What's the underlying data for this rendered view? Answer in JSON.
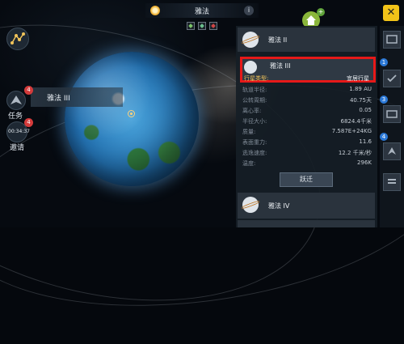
{
  "topbar": {
    "title": "雅法"
  },
  "left": {
    "mission_label": "任务",
    "mission_badge": "4",
    "timer_value": "00:34:37",
    "timer_label": "邀请",
    "timer_badge": "4",
    "planet_tag": "雅法 III",
    "planet_tag_badge": "4"
  },
  "panel": {
    "card_top": "雅法 II",
    "selected": {
      "name": "雅法 III",
      "type_key": "行星类型:",
      "type_value": "宜居行星"
    },
    "rows": [
      {
        "key": "轨道半径:",
        "value": "1.89 AU"
      },
      {
        "key": "公转周期:",
        "value": "40.75天"
      },
      {
        "key": "离心率:",
        "value": "0.05"
      },
      {
        "key": "半径大小:",
        "value": "6824.4千米"
      },
      {
        "key": "质量:",
        "value": "7.587E+24KG"
      },
      {
        "key": "表面重力:",
        "value": "11.6"
      },
      {
        "key": "逃逸速度:",
        "value": "12.2 千米/秒"
      },
      {
        "key": "温度:",
        "value": "296K"
      }
    ],
    "jump_label": "跃迁",
    "card_bottom": "雅法 IV"
  },
  "sidebar": {
    "badges": [
      "1",
      "3",
      "4"
    ]
  },
  "close_label": "✕",
  "info_label": "i",
  "home_plus": "+"
}
